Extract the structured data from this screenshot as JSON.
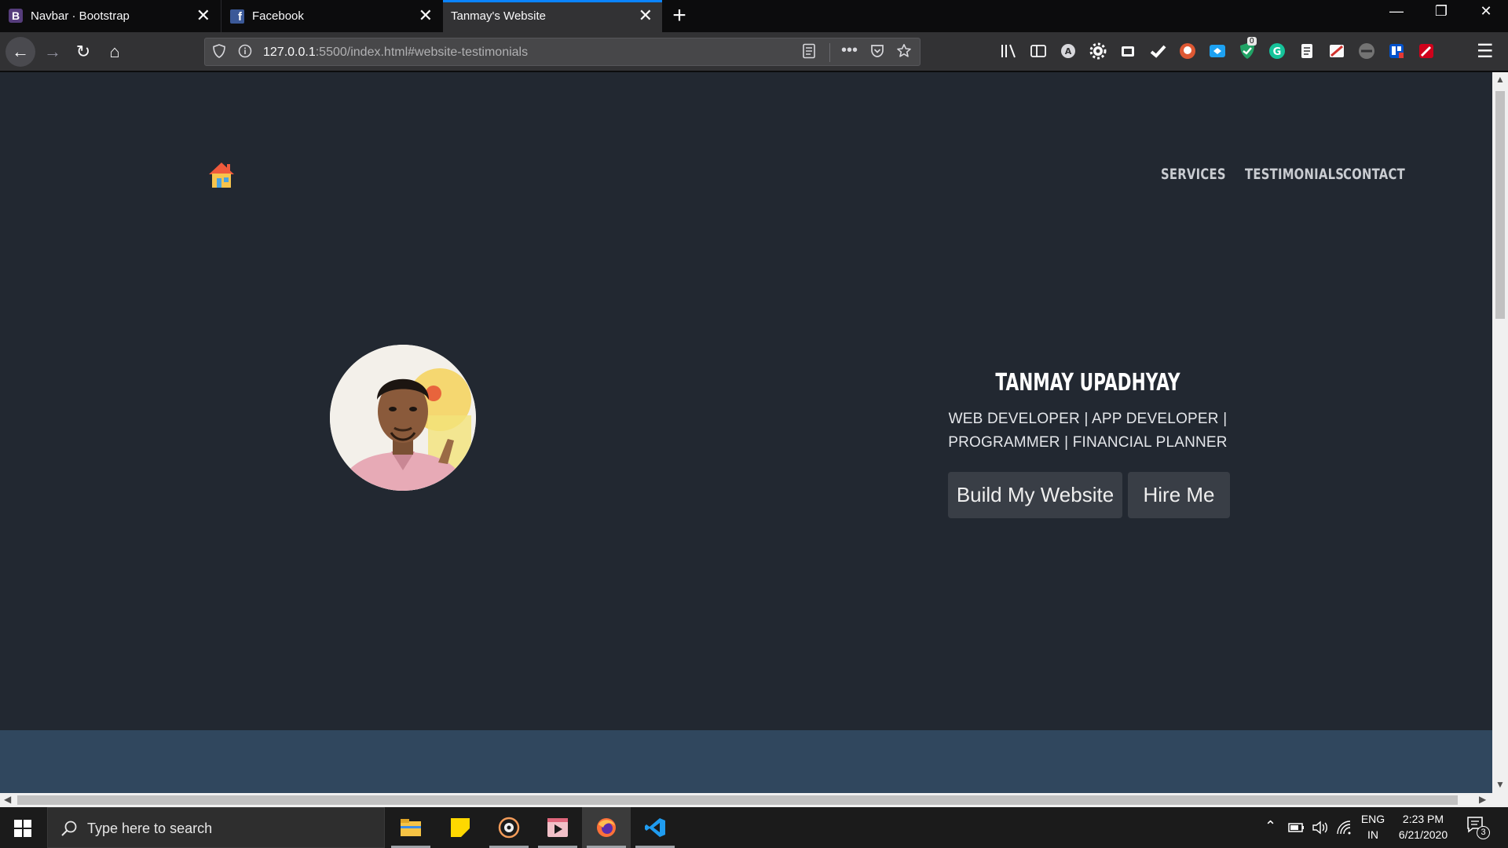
{
  "browser": {
    "tabs": [
      {
        "label": "Navbar · Bootstrap",
        "favicon": "B"
      },
      {
        "label": "Facebook",
        "favicon": "f"
      },
      {
        "label": "Tanmay's Website",
        "active": true
      }
    ],
    "close_glyph": "✕",
    "new_tab_glyph": "+",
    "url_host": "127.0.0.1",
    "url_rest": ":5500/index.html#website-testimonials",
    "extension_badge": "0"
  },
  "site": {
    "nav": {
      "services": "SERVICES",
      "testimonials": "TESTIMONIALS",
      "contact": "CONTACT"
    },
    "hero": {
      "name": "TANMAY UPADHYAY",
      "tagline": "WEB DEVELOPER | APP DEVELOPER | PROGRAMMER | FINANCIAL PLANNER",
      "build_button": "Build My Website",
      "hire_button": "Hire Me"
    },
    "colors": {
      "background": "#222831",
      "button": "#393e46",
      "next_section": "#30475e"
    }
  },
  "taskbar": {
    "search_placeholder": "Type here to search",
    "language": "ENG",
    "region": "IN",
    "time": "2:23 PM",
    "date": "6/21/2020",
    "notification_count": "3"
  }
}
